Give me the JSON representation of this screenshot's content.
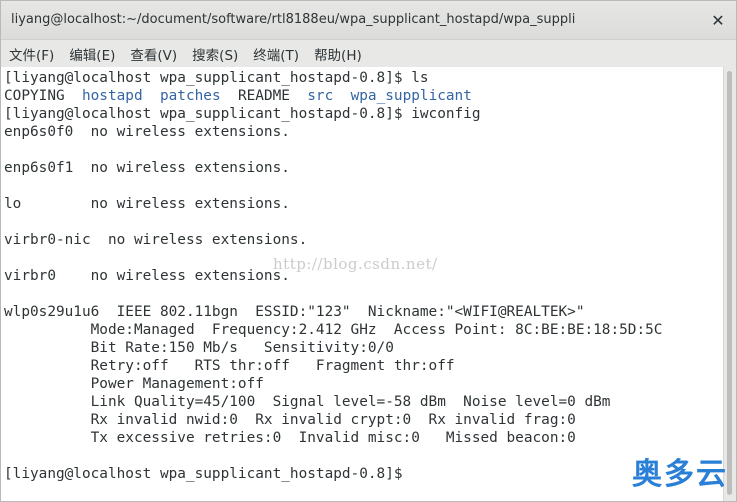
{
  "window": {
    "title": "liyang@localhost:~/document/software/rtl8188eu/wpa_supplicant_hostapd/wpa_suppli",
    "close_glyph": "✕"
  },
  "menu": [
    {
      "label": "文件(F)"
    },
    {
      "label": "编辑(E)"
    },
    {
      "label": "查看(V)"
    },
    {
      "label": "搜索(S)"
    },
    {
      "label": "终端(T)"
    },
    {
      "label": "帮助(H)"
    }
  ],
  "terminal": {
    "prompt": "[liyang@localhost wpa_supplicant_hostapd-0.8]$ ",
    "cmd_ls": "ls",
    "ls_output": [
      {
        "name": "COPYING",
        "type": "file"
      },
      {
        "name": "hostapd",
        "type": "dir"
      },
      {
        "name": "patches",
        "type": "dir"
      },
      {
        "name": "README",
        "type": "file"
      },
      {
        "name": "src",
        "type": "dir"
      },
      {
        "name": "wpa_supplicant",
        "type": "dir"
      }
    ],
    "cmd_iwconfig": "iwconfig",
    "iwconfig_lines": [
      "enp6s0f0  no wireless extensions.",
      "",
      "enp6s0f1  no wireless extensions.",
      "",
      "lo        no wireless extensions.",
      "",
      "virbr0-nic  no wireless extensions.",
      "",
      "virbr0    no wireless extensions.",
      "",
      "wlp0s29u1u6  IEEE 802.11bgn  ESSID:\"123\"  Nickname:\"<WIFI@REALTEK>\"",
      "          Mode:Managed  Frequency:2.412 GHz  Access Point: 8C:BE:BE:18:5D:5C",
      "          Bit Rate:150 Mb/s   Sensitivity:0/0",
      "          Retry:off   RTS thr:off   Fragment thr:off",
      "          Power Management:off",
      "          Link Quality=45/100  Signal level=-58 dBm  Noise level=0 dBm",
      "          Rx invalid nwid:0  Rx invalid crypt:0  Rx invalid frag:0",
      "          Tx excessive retries:0  Invalid misc:0   Missed beacon:0",
      ""
    ],
    "final_prompt": "[liyang@localhost wpa_supplicant_hostapd-0.8]$ "
  },
  "watermark": "http://blog.csdn.net/",
  "logo": "奥多云",
  "colors": {
    "directory": "#3465a4",
    "text": "#2e3436",
    "terminal_bg": "#ffffff"
  }
}
